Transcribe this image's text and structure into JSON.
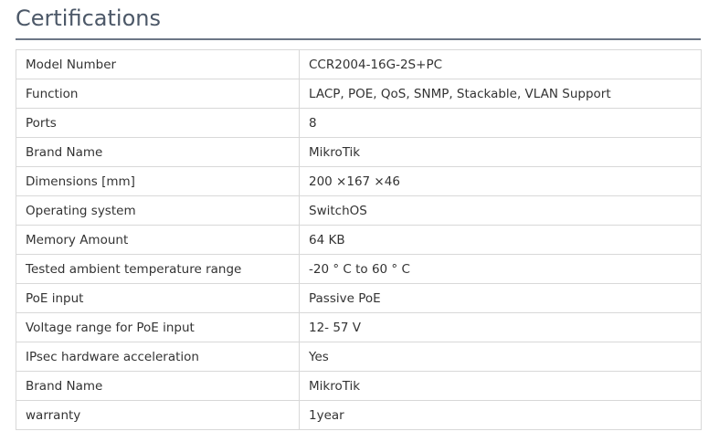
{
  "section": {
    "title": "Certifications"
  },
  "specs": [
    {
      "label": "Model Number",
      "value": "CCR2004-16G-2S+PC"
    },
    {
      "label": "Function",
      "value": "LACP, POE, QoS, SNMP, Stackable, VLAN Support"
    },
    {
      "label": "Ports",
      "value": "8"
    },
    {
      "label": "Brand Name",
      "value": "MikroTik"
    },
    {
      "label": "Dimensions [mm]",
      "value": "200 ×167 ×46"
    },
    {
      "label": "Operating system",
      "value": "SwitchOS"
    },
    {
      "label": "Memory Amount",
      "value": "64 KB"
    },
    {
      "label": "Tested ambient temperature range",
      "value": "-20 ° C to 60 ° C"
    },
    {
      "label": "PoE input",
      "value": "Passive PoE"
    },
    {
      "label": "Voltage range for PoE input",
      "value": "12- 57 V"
    },
    {
      "label": "IPsec hardware acceleration",
      "value": "Yes"
    },
    {
      "label": "Brand Name",
      "value": "MikroTik"
    },
    {
      "label": "warranty",
      "value": "1year"
    }
  ]
}
